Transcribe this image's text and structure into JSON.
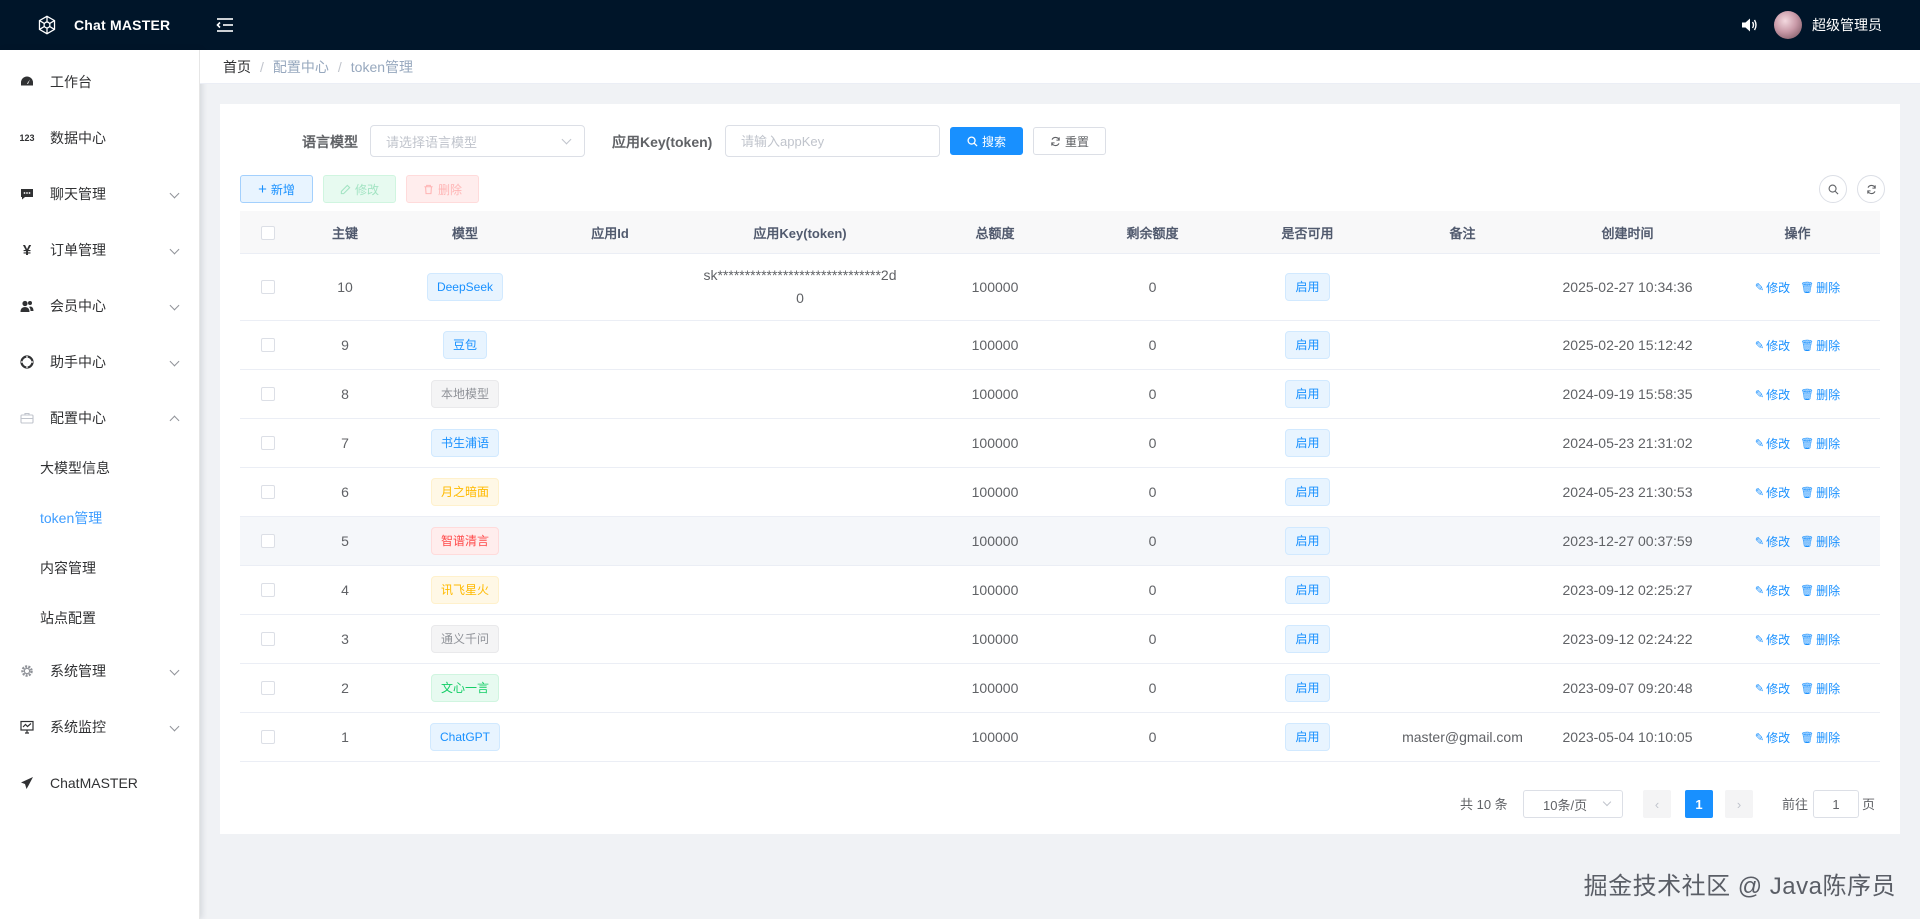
{
  "app": {
    "title": "Chat MASTER",
    "user": "超级管理员"
  },
  "sidebar": {
    "items": [
      {
        "label": "工作台",
        "icon": "dashboard-icon"
      },
      {
        "label": "数据中心",
        "icon": "numbers-icon"
      },
      {
        "label": "聊天管理",
        "icon": "chat-icon"
      },
      {
        "label": "订单管理",
        "icon": "yen-icon"
      },
      {
        "label": "会员中心",
        "icon": "members-icon"
      },
      {
        "label": "助手中心",
        "icon": "lifebuoy-icon"
      },
      {
        "label": "配置中心",
        "icon": "toolbox-icon"
      },
      {
        "label": "系统管理",
        "icon": "gear-icon"
      },
      {
        "label": "系统监控",
        "icon": "monitor-icon"
      },
      {
        "label": "ChatMASTER",
        "icon": "send-icon"
      }
    ],
    "config_children": [
      "大模型信息",
      "token管理",
      "内容管理",
      "站点配置"
    ],
    "active_child": "token管理"
  },
  "breadcrumb": [
    "首页",
    "配置中心",
    "token管理"
  ],
  "search": {
    "model_label": "语言模型",
    "model_placeholder": "请选择语言模型",
    "key_label": "应用Key(token)",
    "key_placeholder": "请输入appKey",
    "search_button": "搜索",
    "reset_button": "重置"
  },
  "toolbar": {
    "add": "新增",
    "edit": "修改",
    "delete": "删除"
  },
  "table": {
    "headers": [
      "主键",
      "模型",
      "应用Id",
      "应用Key(token)",
      "总额度",
      "剩余额度",
      "是否可用",
      "备注",
      "创建时间",
      "操作"
    ],
    "rows": [
      {
        "id": "10",
        "model": "DeepSeek",
        "tag_color": "blue",
        "appId": "",
        "token": "sk******************************2d0",
        "total": "100000",
        "remain": "0",
        "status": "启用",
        "remark": "",
        "created": "2025-02-27 10:34:36"
      },
      {
        "id": "9",
        "model": "豆包",
        "tag_color": "blue",
        "appId": "",
        "token": "",
        "total": "100000",
        "remain": "0",
        "status": "启用",
        "remark": "",
        "created": "2025-02-20 15:12:42"
      },
      {
        "id": "8",
        "model": "本地模型",
        "tag_color": "gray",
        "appId": "",
        "token": "",
        "total": "100000",
        "remain": "0",
        "status": "启用",
        "remark": "",
        "created": "2024-09-19 15:58:35"
      },
      {
        "id": "7",
        "model": "书生浦语",
        "tag_color": "blue",
        "appId": "",
        "token": "",
        "total": "100000",
        "remain": "0",
        "status": "启用",
        "remark": "",
        "created": "2024-05-23 21:31:02"
      },
      {
        "id": "6",
        "model": "月之暗面",
        "tag_color": "yellow",
        "appId": "",
        "token": "",
        "total": "100000",
        "remain": "0",
        "status": "启用",
        "remark": "",
        "created": "2024-05-23 21:30:53"
      },
      {
        "id": "5",
        "model": "智谱清言",
        "tag_color": "red",
        "appId": "",
        "token": "",
        "total": "100000",
        "remain": "0",
        "status": "启用",
        "remark": "",
        "created": "2023-12-27 00:37:59"
      },
      {
        "id": "4",
        "model": "讯飞星火",
        "tag_color": "yellow",
        "appId": "",
        "token": "",
        "total": "100000",
        "remain": "0",
        "status": "启用",
        "remark": "",
        "created": "2023-09-12 02:25:27"
      },
      {
        "id": "3",
        "model": "通义千问",
        "tag_color": "gray",
        "appId": "",
        "token": "",
        "total": "100000",
        "remain": "0",
        "status": "启用",
        "remark": "",
        "created": "2023-09-12 02:24:22"
      },
      {
        "id": "2",
        "model": "文心一言",
        "tag_color": "green",
        "appId": "",
        "token": "",
        "total": "100000",
        "remain": "0",
        "status": "启用",
        "remark": "",
        "created": "2023-09-07 09:20:48"
      },
      {
        "id": "1",
        "model": "ChatGPT",
        "tag_color": "blue",
        "appId": "",
        "token": "",
        "total": "100000",
        "remain": "0",
        "status": "启用",
        "remark": "master@gmail.com",
        "created": "2023-05-04 10:10:05"
      }
    ],
    "row_edit": "修改",
    "row_delete": "删除"
  },
  "pagination": {
    "total": "共 10 条",
    "page_size": "10条/页",
    "current": "1",
    "goto_prefix": "前往",
    "goto_value": "1",
    "goto_suffix": "页"
  },
  "watermark": "掘金技术社区 @ Java陈序员",
  "colors": {
    "topbar": "#001529",
    "primary": "#1890ff",
    "background": "#f0f2f5"
  }
}
